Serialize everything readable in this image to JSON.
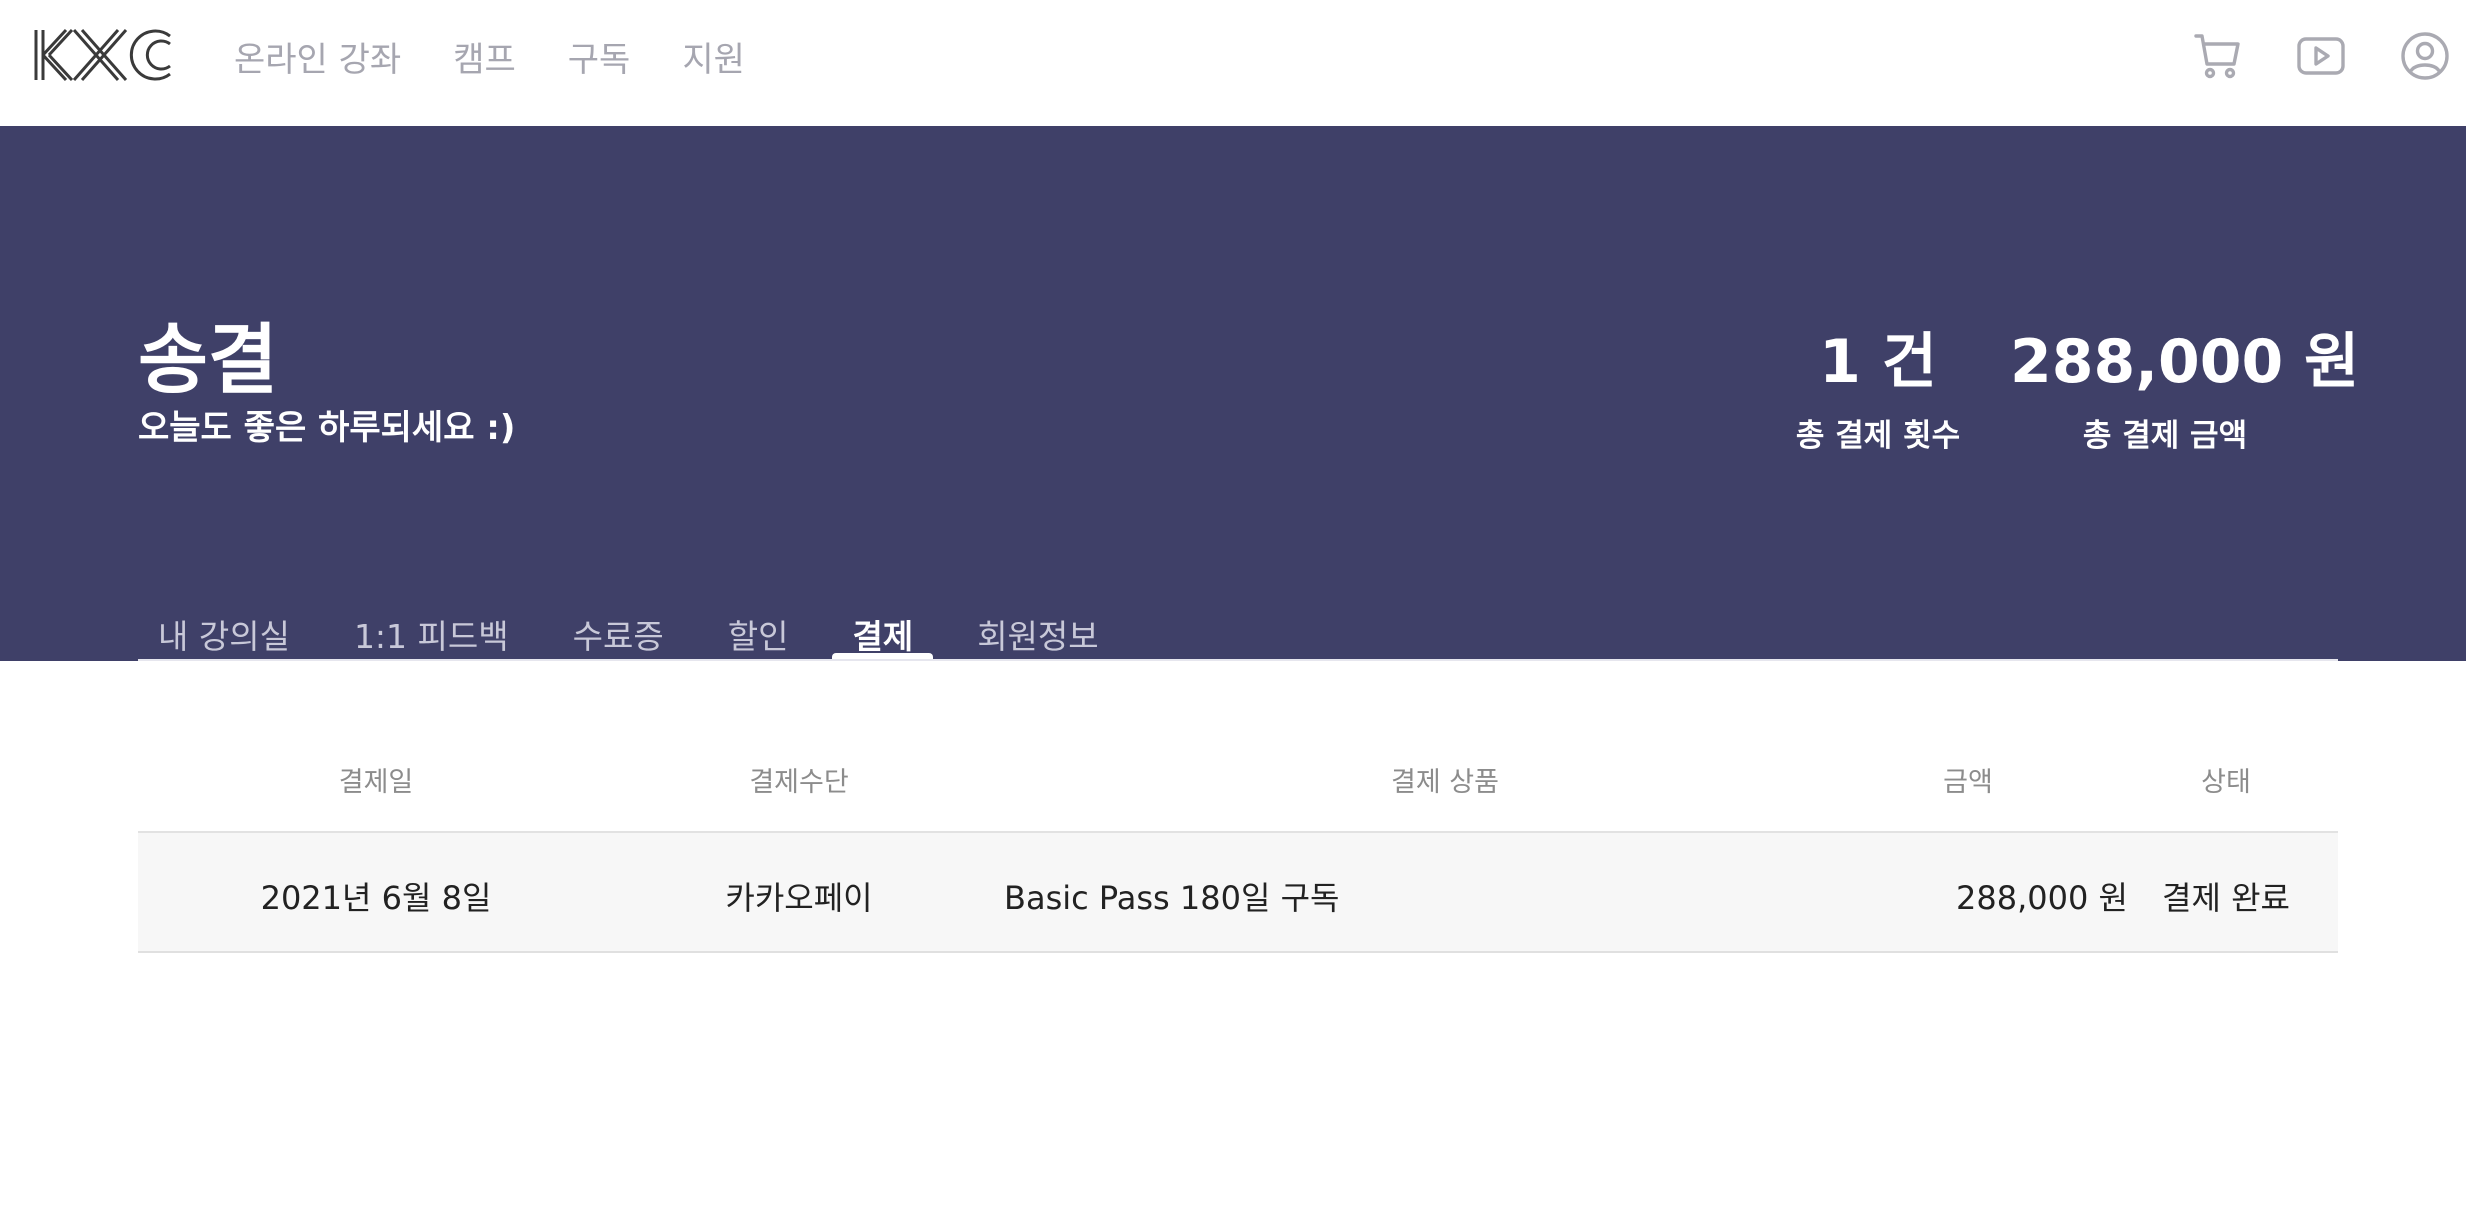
{
  "header": {
    "logo_text": "KXC",
    "nav": [
      "온라인 강좌",
      "캠프",
      "구독",
      "지원"
    ],
    "icons": [
      "cart-icon",
      "play-icon",
      "user-icon"
    ]
  },
  "banner": {
    "user_name": "송결",
    "greeting": "오늘도 좋은 하루되세요 :)",
    "stats": {
      "count_value": "1 건",
      "count_label": "총 결제 횟수",
      "amount_value": "288,000 원",
      "amount_label": "총 결제 금액"
    },
    "tabs": [
      "내 강의실",
      "1:1 피드백",
      "수료증",
      "할인",
      "결제",
      "회원정보"
    ],
    "active_tab": "결제"
  },
  "payments": {
    "columns": [
      "결제일",
      "결제수단",
      "결제 상품",
      "금액",
      "상태"
    ],
    "rows": [
      {
        "date": "2021년 6월 8일",
        "method": "카카오페이",
        "product": "Basic Pass 180일 구독",
        "amount": "288,000 원",
        "status": "결제 완료"
      }
    ]
  },
  "colors": {
    "banner_bg": "#3f4068",
    "nav_text": "#a6a6b0",
    "row_bg": "#f7f7f7"
  }
}
